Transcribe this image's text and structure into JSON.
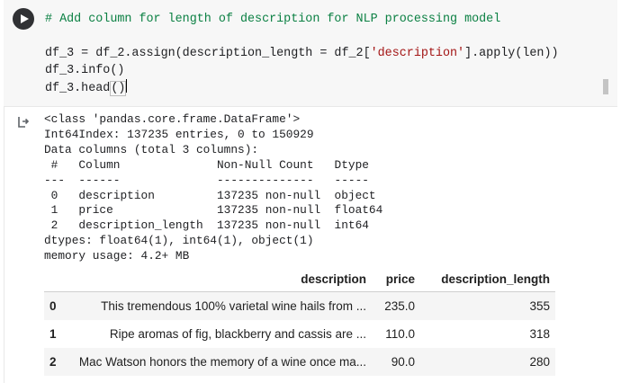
{
  "code_cell": {
    "comment": "# Add column for length of description for NLP processing model",
    "line1_pre": "df_3 = df_2.assign(description_length = df_2[",
    "line1_str": "'description'",
    "line1_post": "].apply(len))",
    "line2": "df_3.info()",
    "line3_pre": "df_3.head",
    "line3_paren": "()"
  },
  "output_text": {
    "lines": [
      "<class 'pandas.core.frame.DataFrame'>",
      "Int64Index: 137235 entries, 0 to 150929",
      "Data columns (total 3 columns):",
      " #   Column              Non-Null Count   Dtype  ",
      "---  ------              --------------   -----  ",
      " 0   description         137235 non-null  object ",
      " 1   price               137235 non-null  float64",
      " 2   description_length  137235 non-null  int64  ",
      "dtypes: float64(1), int64(1), object(1)",
      "memory usage: 4.2+ MB"
    ]
  },
  "dataframe": {
    "headers": [
      "",
      "description",
      "price",
      "description_length"
    ],
    "rows": [
      {
        "index": "0",
        "description": "This tremendous 100% varietal wine hails from ...",
        "price": "235.0",
        "description_length": "355"
      },
      {
        "index": "1",
        "description": "Ripe aromas of fig, blackberry and cassis are ...",
        "price": "110.0",
        "description_length": "318"
      },
      {
        "index": "2",
        "description": "Mac Watson honors the memory of a wine once ma...",
        "price": "90.0",
        "description_length": "280"
      }
    ]
  },
  "icons": {
    "run": "play-icon",
    "output": "output-arrow-icon",
    "toolbar": [
      "move-up-icon",
      "move-down-icon",
      "link-icon",
      "comment-icon",
      "settings-icon",
      "mirror-cell-icon",
      "delete-icon",
      "more-icon"
    ]
  },
  "colors": {
    "comment": "#0b8043",
    "string": "#a31515",
    "cell_bg": "#f7f7f7",
    "table_stripe": "#f5f5f5"
  }
}
